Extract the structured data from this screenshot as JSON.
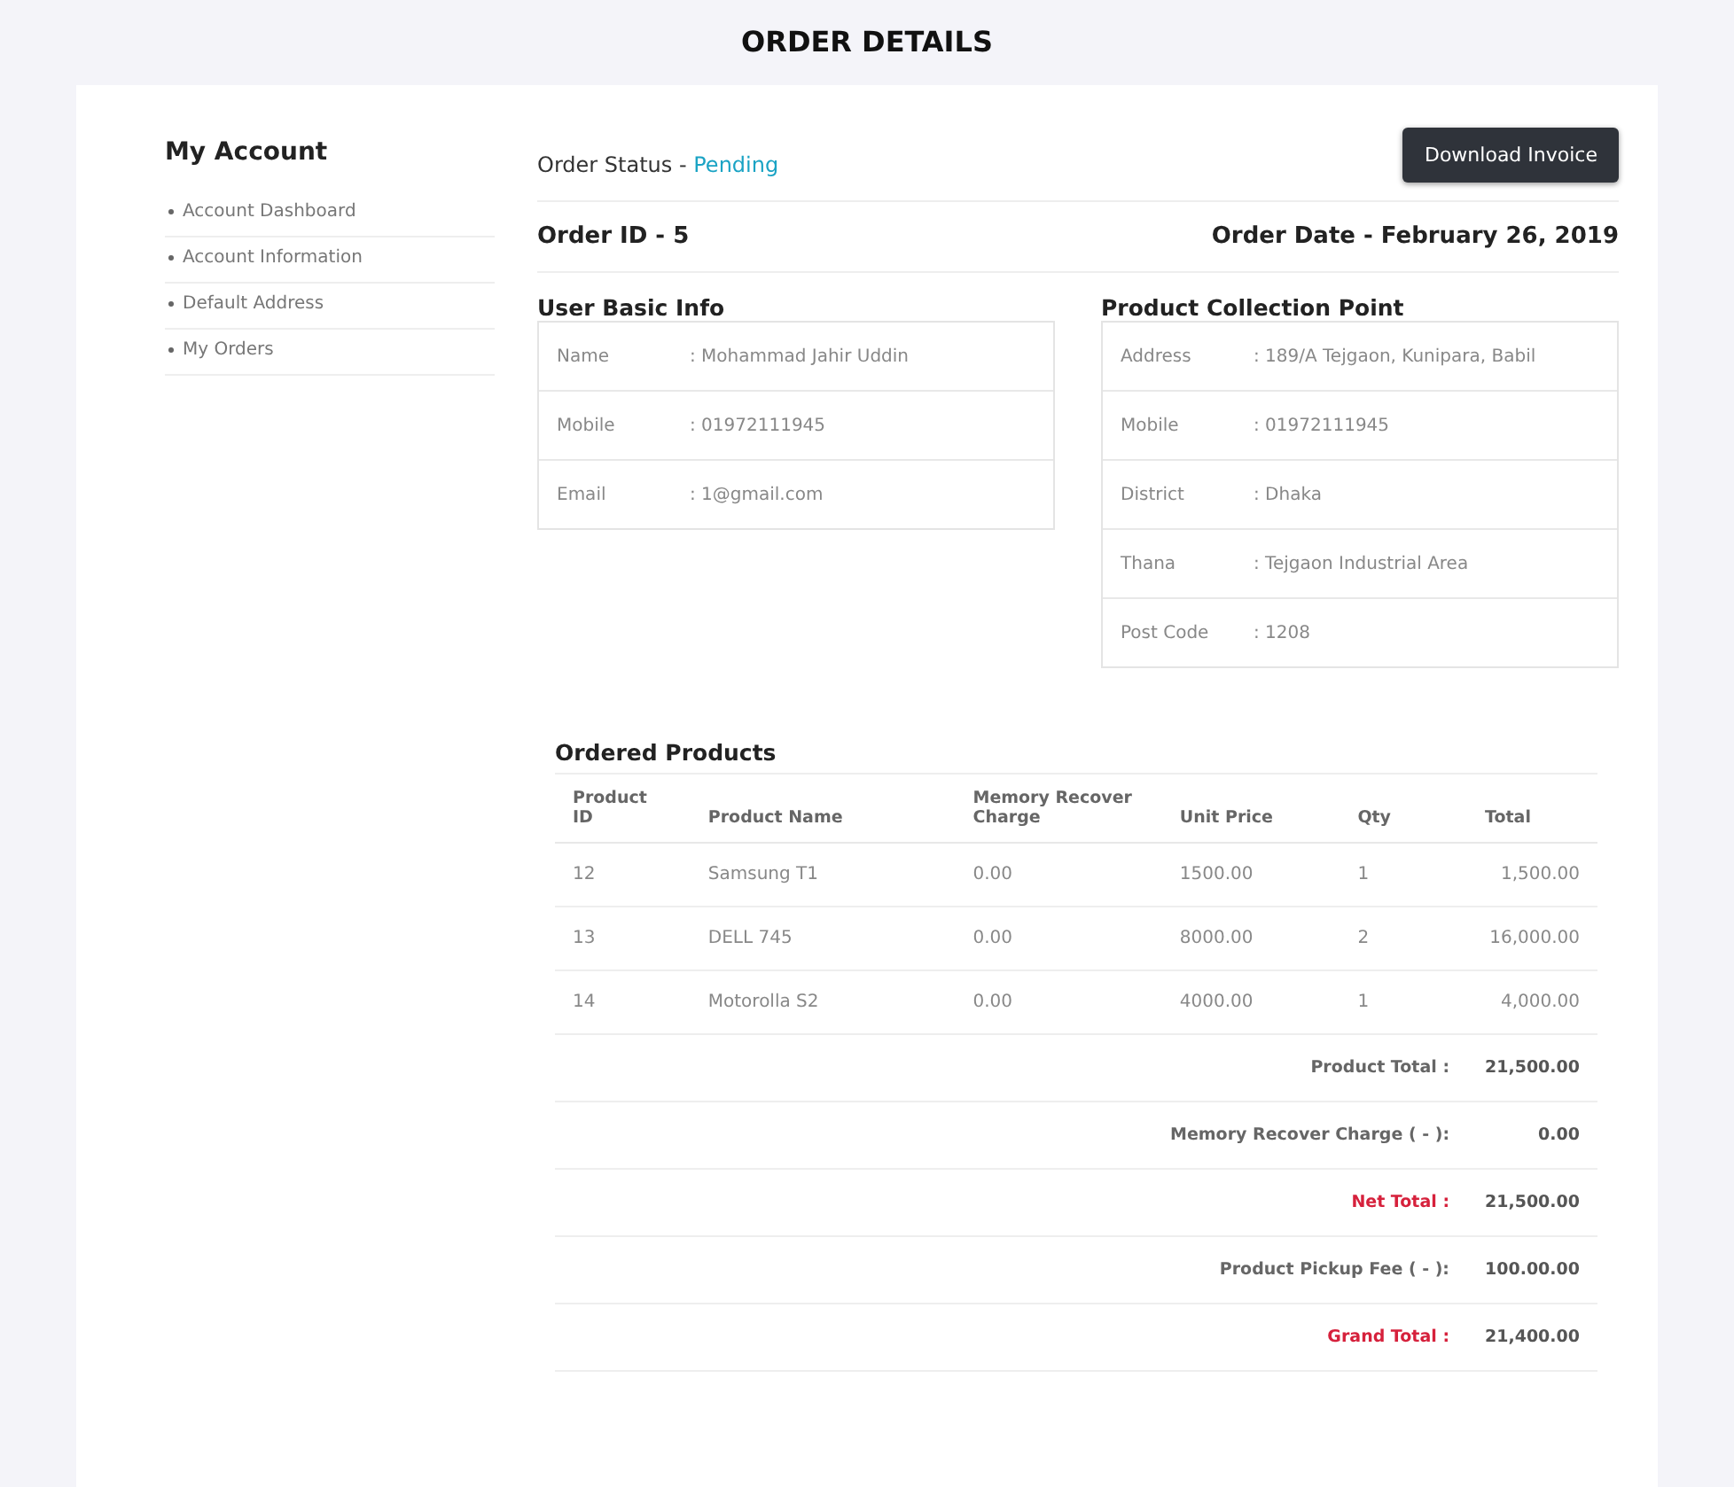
{
  "page_title": "ORDER DETAILS",
  "sidebar": {
    "title": "My Account",
    "items": [
      {
        "label": "Account Dashboard"
      },
      {
        "label": "Account Information"
      },
      {
        "label": "Default Address"
      },
      {
        "label": "My Orders"
      }
    ]
  },
  "order_status": {
    "label": "Order Status - ",
    "value": "Pending"
  },
  "download_button": "Download Invoice",
  "order_id": "Order ID - 5",
  "order_date": "Order Date - February 26, 2019",
  "user_info": {
    "title": "User Basic Info",
    "rows": [
      {
        "label": "Name",
        "value": ": Mohammad Jahir Uddin"
      },
      {
        "label": "Mobile",
        "value": ": 01972111945"
      },
      {
        "label": "Email",
        "value": ": 1@gmail.com"
      }
    ]
  },
  "collection_point": {
    "title": "Product Collection Point",
    "rows": [
      {
        "label": "Address",
        "value": ": 189/A Tejgaon, Kunipara, Babil"
      },
      {
        "label": "Mobile",
        "value": ": 01972111945"
      },
      {
        "label": "District",
        "value": ": Dhaka"
      },
      {
        "label": "Thana",
        "value": ": Tejgaon Industrial Area"
      },
      {
        "label": "Post Code",
        "value": ": 1208"
      }
    ]
  },
  "ordered_products": {
    "title": "Ordered Products",
    "columns": [
      "Product ID",
      "Product Name",
      "Memory Recover Charge",
      "Unit Price",
      "Qty",
      "Total"
    ],
    "rows": [
      [
        "12",
        "Samsung T1",
        "0.00",
        "1500.00",
        "1",
        "1,500.00"
      ],
      [
        "13",
        "DELL 745",
        "0.00",
        "8000.00",
        "2",
        "16,000.00"
      ],
      [
        "14",
        "Motorolla S2",
        "0.00",
        "4000.00",
        "1",
        "4,000.00"
      ]
    ],
    "summary": [
      {
        "label": "Product Total :",
        "value": "21,500.00",
        "highlight": false
      },
      {
        "label": "Memory Recover Charge ( - ):",
        "value": "0.00",
        "highlight": false
      },
      {
        "label": "Net Total :",
        "value": "21,500.00",
        "highlight": true
      },
      {
        "label": "Product Pickup Fee ( - ):",
        "value": "100.00.00",
        "highlight": false
      },
      {
        "label": "Grand Total :",
        "value": "21,400.00",
        "highlight": true
      }
    ]
  }
}
